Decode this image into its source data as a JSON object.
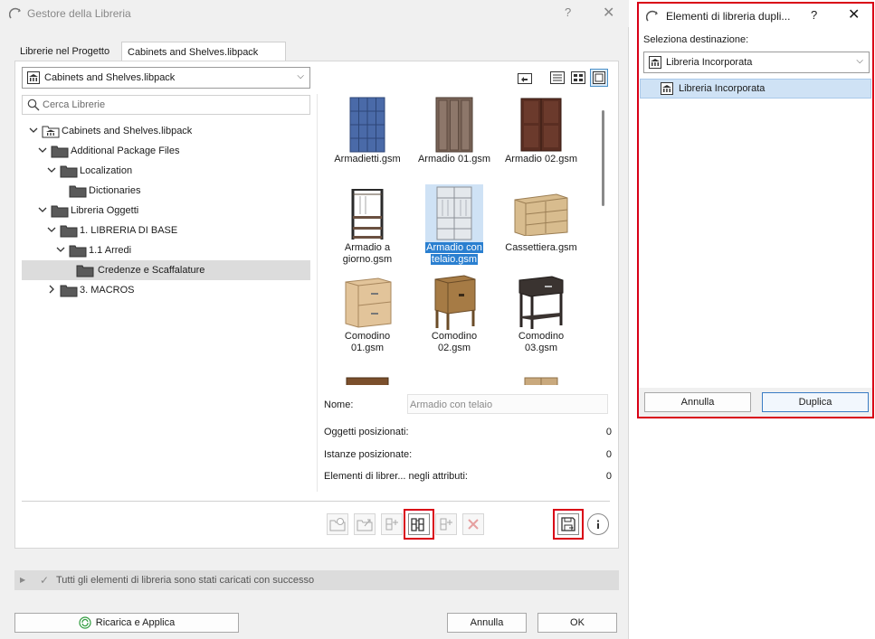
{
  "main_dialog": {
    "title": "Gestore della Libreria",
    "help_glyph": "?",
    "close_glyph": "✕",
    "tabs": [
      {
        "label": "Librerie nel Progetto",
        "selected": false
      },
      {
        "label": "Cabinets and Shelves.libpack",
        "selected": true
      }
    ],
    "library_select": {
      "value": "Cabinets and Shelves.libpack"
    },
    "search": {
      "placeholder": "Cerca Librerie"
    },
    "tree": [
      {
        "label": "Cabinets and Shelves.libpack",
        "icon": "library-icon",
        "expanded": true
      },
      {
        "label": "Additional Package Files",
        "icon": "folder-icon",
        "expanded": true
      },
      {
        "label": "Localization",
        "icon": "folder-icon",
        "expanded": true
      },
      {
        "label": "Dictionaries",
        "icon": "folder-icon"
      },
      {
        "label": "Libreria Oggetti",
        "icon": "folder-icon",
        "expanded": true
      },
      {
        "label": "1. LIBRERIA DI BASE",
        "icon": "folder-icon",
        "expanded": true
      },
      {
        "label": "1.1 Arredi",
        "icon": "folder-icon",
        "expanded": true
      },
      {
        "label": "Credenze e Scaffalature",
        "icon": "folder-icon",
        "selected": true
      },
      {
        "label": "3. MACROS",
        "icon": "folder-icon",
        "expanded": false
      }
    ],
    "objects": [
      {
        "line1": "Armadietti.gsm",
        "line2": "",
        "icon": "lockers-icon"
      },
      {
        "line1": "Armadio 01.gsm",
        "line2": "",
        "icon": "wardrobe-icon"
      },
      {
        "line1": "Armadio 02.gsm",
        "line2": "",
        "icon": "wardrobe-dark-icon"
      },
      {
        "line1": "Armadio a",
        "line2": "giorno.gsm",
        "icon": "coat-rack-icon"
      },
      {
        "line1": "Armadio con",
        "line2": "telaio.gsm",
        "icon": "frame-wardrobe-icon",
        "selected": true
      },
      {
        "line1": "Cassettiera.gsm",
        "line2": "",
        "icon": "chest-of-drawers-icon"
      },
      {
        "line1": "Comodino",
        "line2": "01.gsm",
        "icon": "nightstand-icon"
      },
      {
        "line1": "Comodino",
        "line2": "02.gsm",
        "icon": "nightstand-icon"
      },
      {
        "line1": "Comodino",
        "line2": "03.gsm",
        "icon": "nightstand-icon"
      }
    ],
    "info": {
      "name_label": "Nome:",
      "name_value": "Armadio con telaio",
      "placed_objects_label": "Oggetti posizionati:",
      "placed_objects_value": "0",
      "placed_instances_label": "Istanze posizionate:",
      "placed_instances_value": "0",
      "attr_elements_label": "Elementi di librer... negli attributi:",
      "attr_elements_value": "0"
    },
    "status_message": "Tutti gli elementi di libreria sono stati caricati con successo",
    "buttons": {
      "reload": "Ricarica e Applica",
      "cancel": "Annulla",
      "ok": "OK"
    }
  },
  "side_dialog": {
    "title": "Elementi di libreria dupli...",
    "help_glyph": "?",
    "close_glyph": "✕",
    "destination_label": "Seleziona destinazione:",
    "destination_value": "Libreria Incorporata",
    "list_item": "Libreria Incorporata",
    "cancel": "Annulla",
    "duplicate": "Duplica"
  },
  "colors": {
    "highlight_red": "#d90016",
    "selection_blue": "#2a7fd0",
    "accent_blue": "#3a7cc4"
  }
}
